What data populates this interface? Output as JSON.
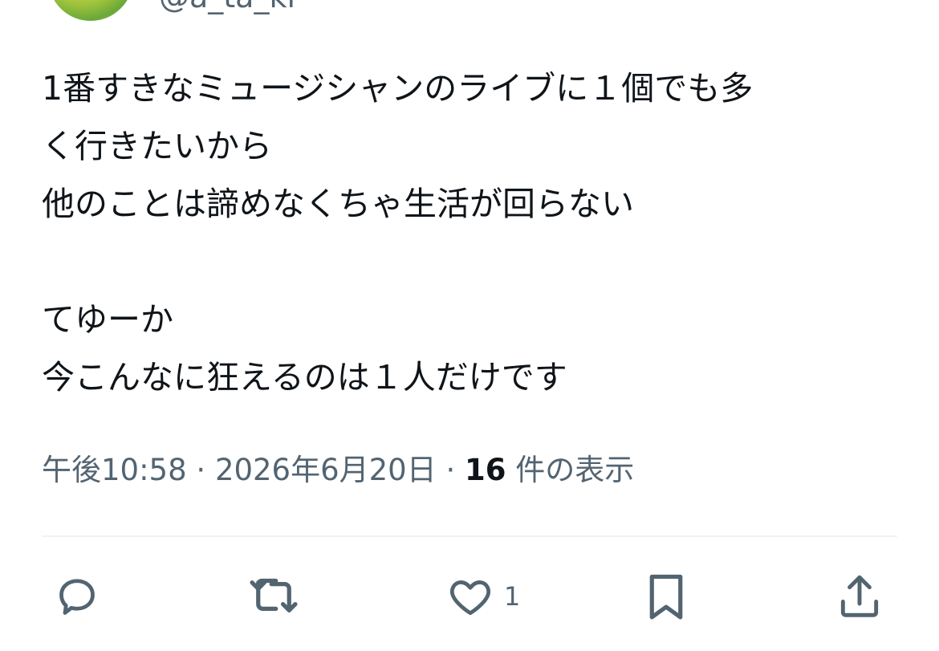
{
  "author": {
    "handle": "@a_ta_ki"
  },
  "tweet": {
    "lines": [
      "1番すきなミュージシャンのライブに１個でも多",
      "く行きたいから",
      "他のことは諦めなくちゃ生活が回らない",
      "",
      "てゆーか",
      "今こんなに狂えるのは１人だけです"
    ]
  },
  "meta": {
    "time": "午後10:58",
    "sep1": " · ",
    "date": "2026年6月20日",
    "sep2": " · ",
    "views_count": "16",
    "views_label": " 件の表示"
  },
  "actions": {
    "reply": {
      "icon": "reply-icon",
      "count": ""
    },
    "retweet": {
      "icon": "retweet-icon",
      "count": ""
    },
    "like": {
      "icon": "heart-icon",
      "count": "1"
    },
    "bookmark": {
      "icon": "bookmark-icon",
      "count": ""
    },
    "share": {
      "icon": "share-icon",
      "count": ""
    }
  },
  "colors": {
    "text": "#0f1419",
    "secondary": "#536471",
    "divider": "#eff3f4"
  }
}
